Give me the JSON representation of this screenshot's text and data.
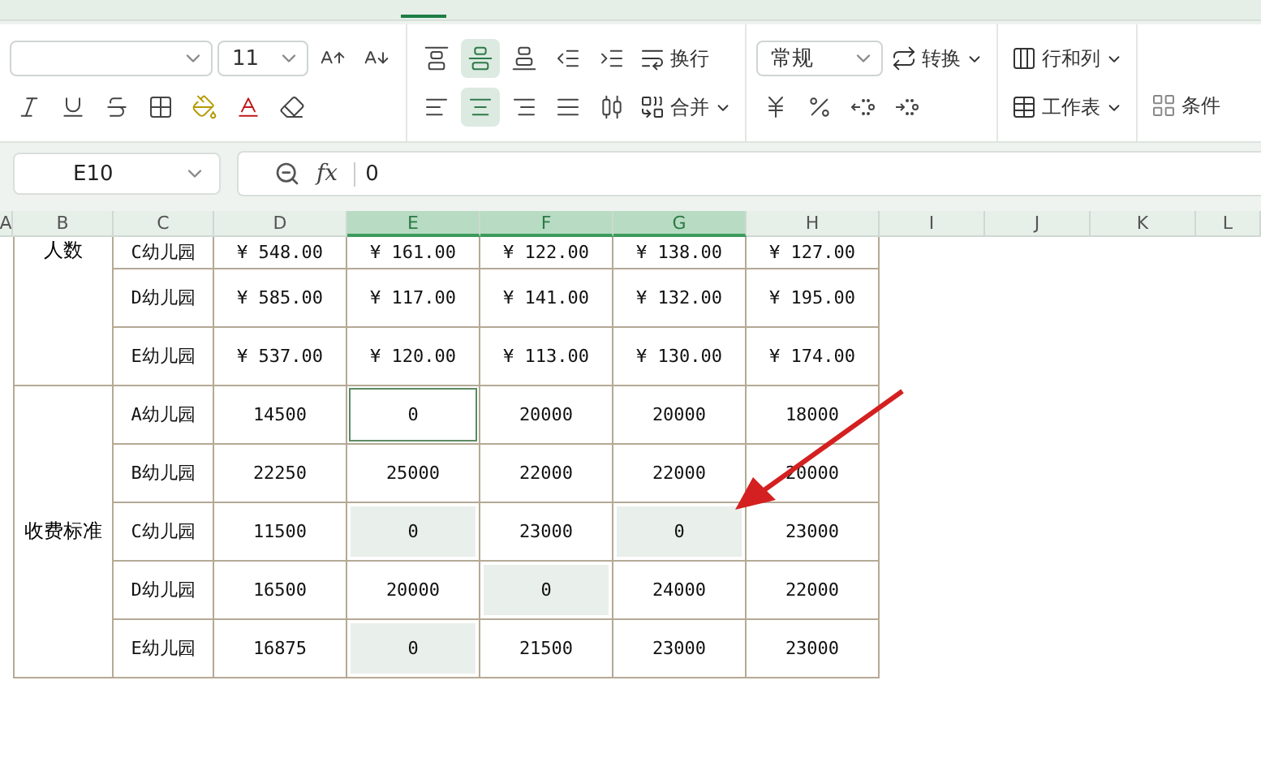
{
  "ribbon": {
    "font_size": {
      "value": "11"
    },
    "alignment": [
      {
        "kind": "top",
        "selected": false
      },
      {
        "kind": "middle",
        "selected": true
      },
      {
        "kind": "bottom",
        "selected": false
      },
      {
        "kind": "outdent",
        "selected": false
      },
      {
        "kind": "indent",
        "selected": false
      },
      {
        "kind": "left",
        "selected": false
      },
      {
        "kind": "center",
        "selected": true
      },
      {
        "kind": "right",
        "selected": false
      },
      {
        "kind": "justify",
        "selected": false
      },
      {
        "kind": "distribute",
        "selected": false
      }
    ],
    "wrap_label": "换行",
    "merge_label": "合并",
    "number_format": {
      "value": "常规"
    },
    "convert_label": "转换",
    "rows_cols_label": "行和列",
    "worksheet_label": "工作表",
    "conditional_label": "条件"
  },
  "formula_bar": {
    "name_box": "E10",
    "fx": "fx",
    "value": "0"
  },
  "columns": [
    {
      "label": "A",
      "selected": false
    },
    {
      "label": "B",
      "selected": false
    },
    {
      "label": "C",
      "selected": false
    },
    {
      "label": "D",
      "selected": false
    },
    {
      "label": "E",
      "selected": true
    },
    {
      "label": "F",
      "selected": true
    },
    {
      "label": "G",
      "selected": true
    },
    {
      "label": "H",
      "selected": false
    },
    {
      "label": "I",
      "selected": false
    },
    {
      "label": "J",
      "selected": false
    },
    {
      "label": "K",
      "selected": false
    },
    {
      "label": "L",
      "selected": false
    }
  ],
  "sections": [
    {
      "label": "人数",
      "rows": [
        {
          "name": "C幼儿园",
          "cells": [
            {
              "text": "¥ 548.00",
              "highlighted": false,
              "selected": false
            },
            {
              "text": "¥ 161.00",
              "highlighted": false,
              "selected": false
            },
            {
              "text": "¥ 122.00",
              "highlighted": false,
              "selected": false
            },
            {
              "text": "¥ 138.00",
              "highlighted": false,
              "selected": false
            },
            {
              "text": "¥ 127.00",
              "highlighted": false,
              "selected": false
            }
          ]
        },
        {
          "name": "D幼儿园",
          "cells": [
            {
              "text": "¥ 585.00",
              "highlighted": false,
              "selected": false
            },
            {
              "text": "¥ 117.00",
              "highlighted": false,
              "selected": false
            },
            {
              "text": "¥ 141.00",
              "highlighted": false,
              "selected": false
            },
            {
              "text": "¥ 132.00",
              "highlighted": false,
              "selected": false
            },
            {
              "text": "¥ 195.00",
              "highlighted": false,
              "selected": false
            }
          ]
        },
        {
          "name": "E幼儿园",
          "cells": [
            {
              "text": "¥ 537.00",
              "highlighted": false,
              "selected": false
            },
            {
              "text": "¥ 120.00",
              "highlighted": false,
              "selected": false
            },
            {
              "text": "¥ 113.00",
              "highlighted": false,
              "selected": false
            },
            {
              "text": "¥ 130.00",
              "highlighted": false,
              "selected": false
            },
            {
              "text": "¥ 174.00",
              "highlighted": false,
              "selected": false
            }
          ]
        }
      ]
    },
    {
      "label": "收费标准",
      "rows": [
        {
          "name": "A幼儿园",
          "cells": [
            {
              "text": "14500",
              "highlighted": false,
              "selected": false
            },
            {
              "text": "0",
              "highlighted": false,
              "selected": true
            },
            {
              "text": "20000",
              "highlighted": false,
              "selected": false
            },
            {
              "text": "20000",
              "highlighted": false,
              "selected": false
            },
            {
              "text": "18000",
              "highlighted": false,
              "selected": false
            }
          ]
        },
        {
          "name": "B幼儿园",
          "cells": [
            {
              "text": "22250",
              "highlighted": false,
              "selected": false
            },
            {
              "text": "25000",
              "highlighted": false,
              "selected": false
            },
            {
              "text": "22000",
              "highlighted": false,
              "selected": false
            },
            {
              "text": "22000",
              "highlighted": false,
              "selected": false
            },
            {
              "text": "20000",
              "highlighted": false,
              "selected": false
            }
          ]
        },
        {
          "name": "C幼儿园",
          "cells": [
            {
              "text": "11500",
              "highlighted": false,
              "selected": false
            },
            {
              "text": "0",
              "highlighted": true,
              "selected": false
            },
            {
              "text": "23000",
              "highlighted": false,
              "selected": false
            },
            {
              "text": "0",
              "highlighted": true,
              "selected": false
            },
            {
              "text": "23000",
              "highlighted": false,
              "selected": false
            }
          ]
        },
        {
          "name": "D幼儿园",
          "cells": [
            {
              "text": "16500",
              "highlighted": false,
              "selected": false
            },
            {
              "text": "20000",
              "highlighted": false,
              "selected": false
            },
            {
              "text": "0",
              "highlighted": true,
              "selected": false
            },
            {
              "text": "24000",
              "highlighted": false,
              "selected": false
            },
            {
              "text": "22000",
              "highlighted": false,
              "selected": false
            }
          ]
        },
        {
          "name": "E幼儿园",
          "cells": [
            {
              "text": "16875",
              "highlighted": false,
              "selected": false
            },
            {
              "text": "0",
              "highlighted": true,
              "selected": false
            },
            {
              "text": "21500",
              "highlighted": false,
              "selected": false
            },
            {
              "text": "23000",
              "highlighted": false,
              "selected": false
            },
            {
              "text": "23000",
              "highlighted": false,
              "selected": false
            }
          ]
        }
      ]
    }
  ]
}
